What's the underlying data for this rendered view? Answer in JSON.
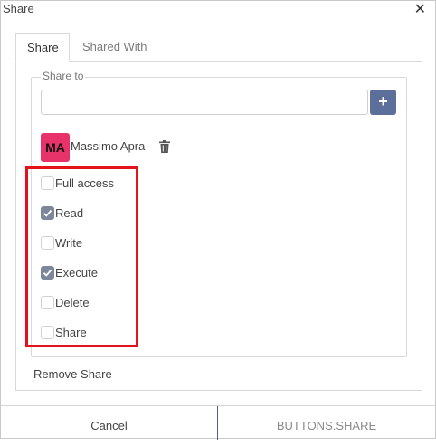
{
  "dialog": {
    "title": "Share",
    "close_icon": "close-icon"
  },
  "tabs": [
    {
      "label": "Share",
      "active": true
    },
    {
      "label": "Shared With",
      "active": false
    }
  ],
  "share_to": {
    "legend": "Share to",
    "input_value": "",
    "add_label": "+"
  },
  "user": {
    "initials": "MA",
    "name": "Massimo Apra",
    "avatar_color": "#e8336a"
  },
  "permissions": [
    {
      "label": "Full access",
      "checked": false
    },
    {
      "label": "Read",
      "checked": true
    },
    {
      "label": "Write",
      "checked": false
    },
    {
      "label": "Execute",
      "checked": true
    },
    {
      "label": "Delete",
      "checked": false
    },
    {
      "label": "Share",
      "checked": false
    }
  ],
  "remove_share_label": "Remove Share",
  "footer": {
    "cancel_label": "Cancel",
    "share_label": "BUTTONS.SHARE"
  },
  "colors": {
    "highlight": "#e3121b",
    "accent": "#5b6f9a",
    "checkbox_checked": "#7c879c"
  }
}
